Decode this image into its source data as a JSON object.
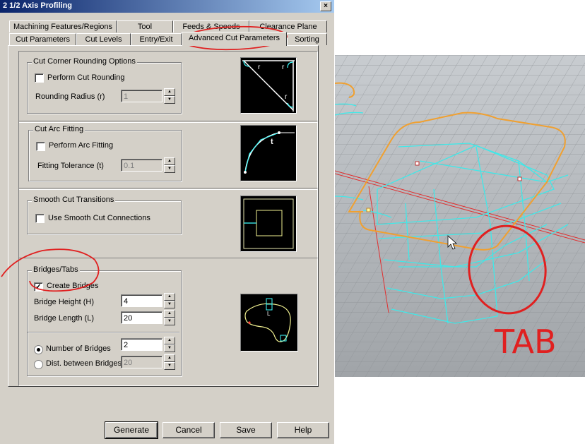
{
  "window": {
    "title": "2 1/2 Axis Profiling",
    "close_glyph": "×"
  },
  "tabs_row1": [
    "Machining Features/Regions",
    "Tool",
    "Feeds & Speeds",
    "Clearance Plane"
  ],
  "tabs_row2": [
    "Cut Parameters",
    "Cut Levels",
    "Entry/Exit",
    "Advanced Cut Parameters",
    "Sorting"
  ],
  "corner": {
    "title": "Cut Corner Rounding Options",
    "checkbox": "Perform Cut Rounding",
    "radius_label": "Rounding Radius (r)",
    "radius_value": "1",
    "preview_label": "r"
  },
  "arc": {
    "title": "Cut Arc Fitting",
    "checkbox": "Perform Arc Fitting",
    "tol_label": "Fitting Tolerance (t)",
    "tol_value": "0.1",
    "preview_label": "t"
  },
  "smooth": {
    "title": "Smooth Cut Transitions",
    "checkbox": "Use Smooth Cut Connections"
  },
  "bridges": {
    "title": "Bridges/Tabs",
    "checkbox": "Create Bridges",
    "check_glyph": "✓",
    "height_label": "Bridge Height (H)",
    "height_value": "4",
    "length_label": "Bridge Length (L)",
    "length_value": "20",
    "num_label": "Number of Bridges",
    "num_value": "2",
    "dist_label": "Dist. between Bridges",
    "dist_value": "20",
    "preview_label": "L"
  },
  "buttons": {
    "generate": "Generate",
    "cancel": "Cancel",
    "save": "Save",
    "help": "Help"
  },
  "annotation": {
    "text": "TAB"
  },
  "colors": {
    "titlebar": "#0a246a",
    "dialog": "#d4d0c8",
    "toolpath": "#f0a030",
    "mesh": "#40e0e0",
    "annotation": "#e02020"
  }
}
